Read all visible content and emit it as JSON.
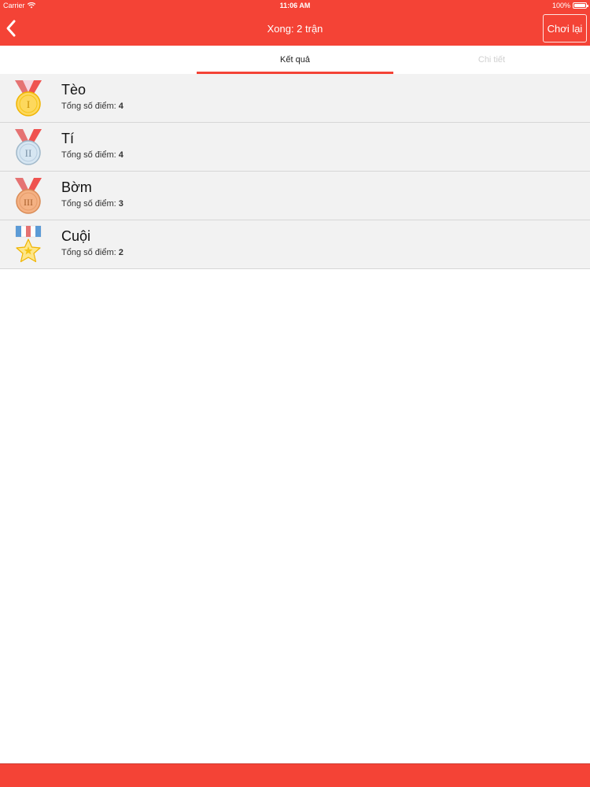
{
  "status": {
    "carrier": "Carrier",
    "time": "11:06 AM",
    "battery": "100%"
  },
  "header": {
    "title": "Xong: 2 trận",
    "replay_label": "Chơi lại",
    "back_icon": "chevron-left-icon"
  },
  "tabs": [
    {
      "label": "Kết quả",
      "active": true
    },
    {
      "label": "Chi tiết",
      "active": false
    }
  ],
  "players": [
    {
      "name": "Tèo",
      "score_label": "Tổng số điểm:",
      "score": "4",
      "medal": "gold-medal-icon"
    },
    {
      "name": "Tí",
      "score_label": "Tổng số điểm:",
      "score": "4",
      "medal": "silver-medal-icon"
    },
    {
      "name": "Bờm",
      "score_label": "Tổng số điểm:",
      "score": "3",
      "medal": "bronze-medal-icon"
    },
    {
      "name": "Cuội",
      "score_label": "Tổng số điểm:",
      "score": "2",
      "medal": "star-medal-icon"
    }
  ],
  "colors": {
    "accent": "#f44336",
    "row_background": "#f2f2f2",
    "inactive_tab": "#d0d0d0"
  }
}
